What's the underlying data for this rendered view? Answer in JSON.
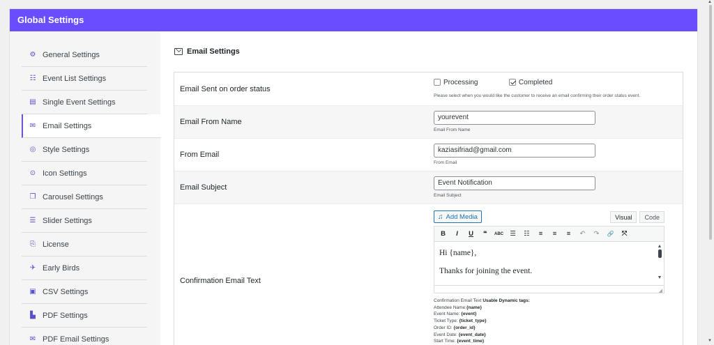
{
  "header": {
    "title": "Global Settings"
  },
  "sidebar": {
    "items": [
      {
        "label": "General Settings",
        "icon": "gear-icon",
        "active": false
      },
      {
        "label": "Event List Settings",
        "icon": "list-icon",
        "active": false
      },
      {
        "label": "Single Event Settings",
        "icon": "calendar-icon",
        "active": false
      },
      {
        "label": "Email Settings",
        "icon": "envelope-icon",
        "active": true
      },
      {
        "label": "Style Settings",
        "icon": "palette-icon",
        "active": false
      },
      {
        "label": "Icon Settings",
        "icon": "target-icon",
        "active": false
      },
      {
        "label": "Carousel Settings",
        "icon": "carousel-icon",
        "active": false
      },
      {
        "label": "Slider Settings",
        "icon": "sliders-icon",
        "active": false
      },
      {
        "label": "License",
        "icon": "license-icon",
        "active": false
      },
      {
        "label": "Early Birds",
        "icon": "bird-icon",
        "active": false
      },
      {
        "label": "CSV Settings",
        "icon": "file-icon",
        "active": false
      },
      {
        "label": "PDF Settings",
        "icon": "pdf-icon",
        "active": false
      },
      {
        "label": "PDF Email Settings",
        "icon": "envelope-open-icon",
        "active": false
      }
    ]
  },
  "main": {
    "section_title": "Email Settings",
    "rows": {
      "status": {
        "label": "Email Sent on order status",
        "options": [
          {
            "label": "Processing",
            "checked": false
          },
          {
            "label": "Completed",
            "checked": true
          }
        ],
        "help": "Please select when you would like the customer to receive an email confirming their order status event."
      },
      "from_name": {
        "label": "Email From Name",
        "value": "yourevent",
        "help": "Email From Name"
      },
      "from_email": {
        "label": "From Email",
        "value": "kaziasifriad@gmail.com",
        "help": "From Email"
      },
      "subject": {
        "label": "Email Subject",
        "value": "Event Notification",
        "help": "Email Subject"
      },
      "confirmation": {
        "label": "Confirmation Email Text",
        "add_media": "Add Media",
        "tabs": [
          "Visual",
          "Code"
        ],
        "toolbar": [
          "B",
          "I",
          "U",
          "❝",
          "ABC",
          "☰",
          "☷",
          "≡",
          "≡",
          "≡",
          "↶",
          "↷",
          "🔗",
          "⤧"
        ],
        "content": [
          "Hi {name},",
          "Thanks for joining the event."
        ],
        "help_prefix": "Confirmation Email Text",
        "help_strong": "Usable Dynamic tags:",
        "tags": [
          {
            "name": "Attendee Name:",
            "tag": "{name}"
          },
          {
            "name": "Event Name: ",
            "tag": "{event}"
          },
          {
            "name": "Ticket Type: ",
            "tag": "{ticket_type}"
          },
          {
            "name": "Order ID: ",
            "tag": "{order_id}"
          },
          {
            "name": "Event Date: ",
            "tag": "{event_date}"
          },
          {
            "name": "Start Time: ",
            "tag": "{event_time}"
          }
        ]
      }
    }
  },
  "colors": {
    "accent": "#6a4dff",
    "link": "#2271b1"
  }
}
